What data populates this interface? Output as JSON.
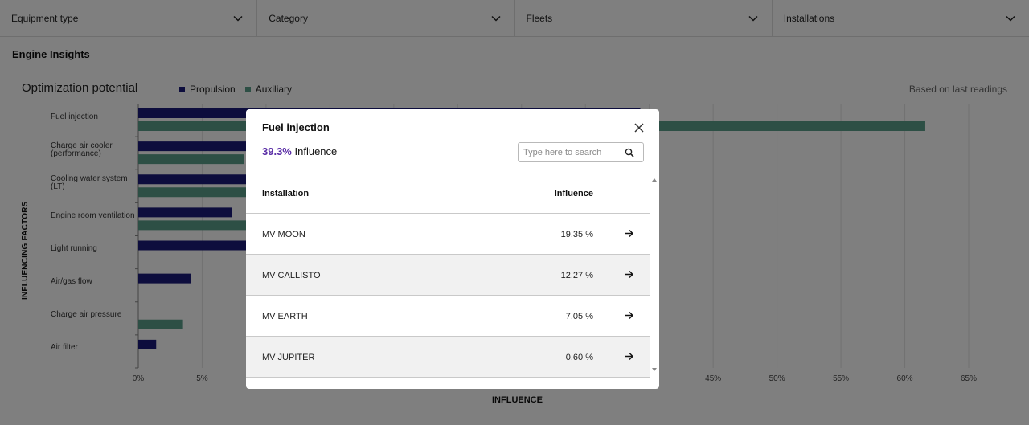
{
  "filters": [
    {
      "label": "Equipment type"
    },
    {
      "label": "Category"
    },
    {
      "label": "Fleets"
    },
    {
      "label": "Installations"
    }
  ],
  "section_title": "Engine Insights",
  "chart_title": "Optimization potential",
  "readings_note": "Based on last readings",
  "colors": {
    "propulsion": "#1a1a7a",
    "auxiliary": "#5a9e8a",
    "accent": "#5a2ea6"
  },
  "chart_data": {
    "type": "bar",
    "orientation": "horizontal",
    "categories": [
      "Fuel injection",
      "Charge air cooler (performance)",
      "Cooling water system (LT)",
      "Engine room ventilation",
      "Light running",
      "Air/gas flow",
      "Charge air pressure",
      "Air filter"
    ],
    "series": [
      {
        "name": "Propulsion",
        "values": [
          39.3,
          12.3,
          25.0,
          7.3,
          12.0,
          4.1,
          null,
          1.4
        ]
      },
      {
        "name": "Auxiliary",
        "values": [
          61.6,
          8.3,
          18.0,
          15.0,
          null,
          null,
          3.5,
          null
        ]
      }
    ],
    "xlim": [
      0,
      65
    ],
    "xticks": [
      "0%",
      "5%",
      "10%",
      "15%",
      "20%",
      "25%",
      "30%",
      "35%",
      "40%",
      "45%",
      "50%",
      "55%",
      "60%",
      "65%"
    ],
    "xlabel": "INFLUENCE",
    "ylabel": "INFLUENCING FACTORS",
    "legend_position": "top-left",
    "grid": true
  },
  "category_labels": [
    [
      "Fuel injection"
    ],
    [
      "Charge air cooler",
      "(performance)"
    ],
    [
      "Cooling water system",
      "(LT)"
    ],
    [
      "Engine room ventilation"
    ],
    [
      "Light running"
    ],
    [
      "Air/gas flow"
    ],
    [
      "Charge air pressure"
    ],
    [
      "Air filter"
    ]
  ],
  "modal": {
    "title": "Fuel injection",
    "influence_pct": "39.3%",
    "influence_label": "Influence",
    "search_placeholder": "Type here to search",
    "columns": {
      "installation": "Installation",
      "influence": "Influence"
    },
    "rows": [
      {
        "name": "MV MOON",
        "value": "19.35 %"
      },
      {
        "name": "MV CALLISTO",
        "value": "12.27 %"
      },
      {
        "name": "MV EARTH",
        "value": "7.05 %"
      },
      {
        "name": "MV JUPITER",
        "value": "0.60 %"
      }
    ]
  }
}
